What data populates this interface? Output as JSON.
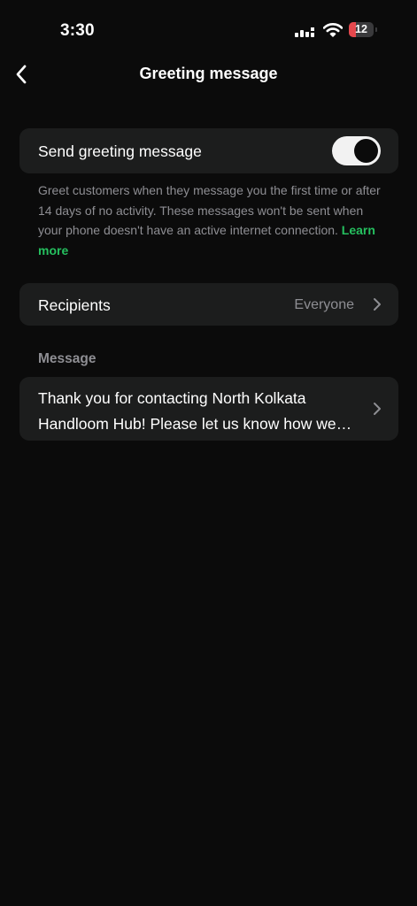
{
  "status_bar": {
    "time": "3:30",
    "battery_level": "12",
    "battery_fraction": 0.12
  },
  "nav": {
    "back_icon": "chevron-left-icon",
    "title": "Greeting message"
  },
  "greeting_toggle": {
    "label": "Send greeting message",
    "enabled": true
  },
  "description": {
    "text": "Greet customers when they message you the first time or after 14 days of no activity. These messages won't be sent when your phone doesn't have an active internet connection.",
    "link_label": "Learn more"
  },
  "recipients": {
    "label": "Recipients",
    "value": "Everyone",
    "icon": "chevron-right-icon"
  },
  "message_section": {
    "header": "Message",
    "text": "Thank you for contacting North Kolkata Handloom Hub! Please let us know how we can help you.",
    "icon": "chevron-right-icon"
  },
  "colors": {
    "background": "#0b0b0b",
    "card": "#1c1d1d",
    "accent_link": "#25c05f",
    "secondary_text": "#8e8e93",
    "battery_low": "#e5484d"
  }
}
